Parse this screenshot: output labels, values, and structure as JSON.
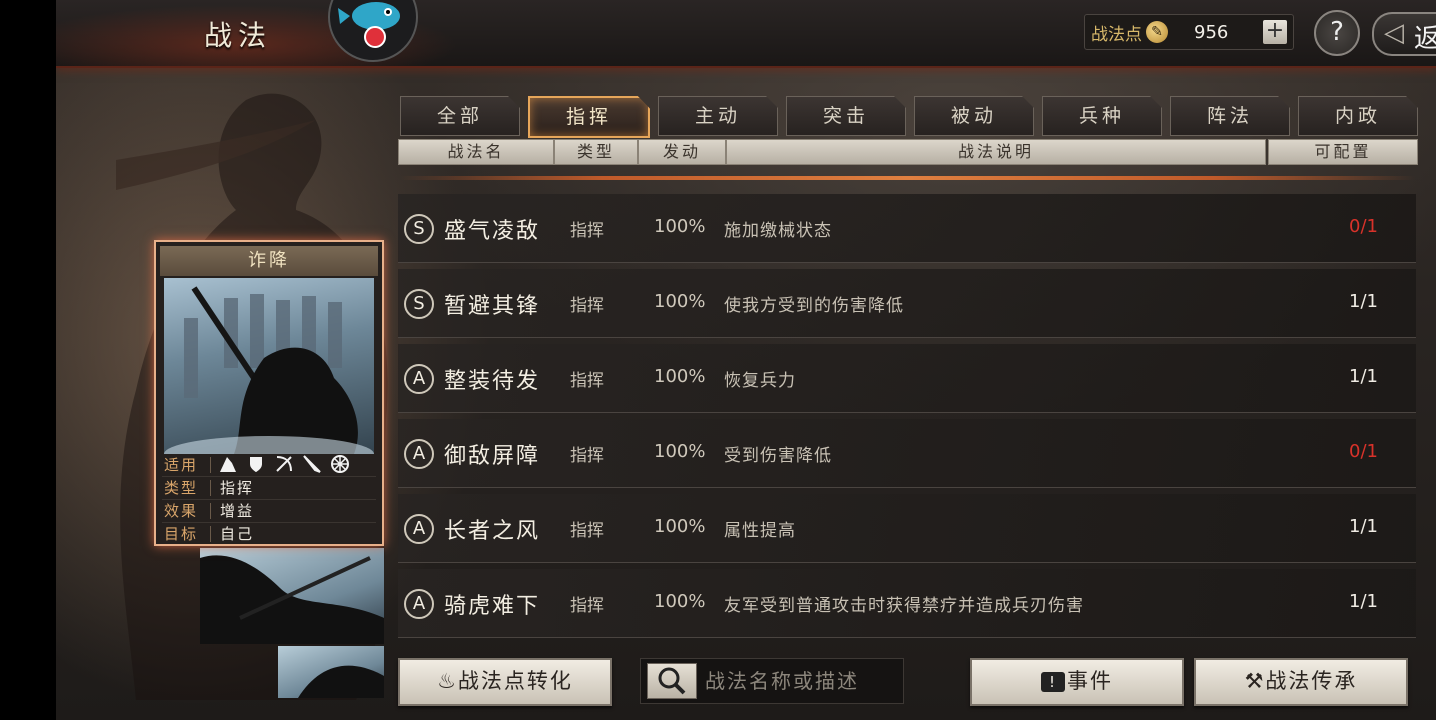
{
  "header": {
    "title": "战法",
    "points_label": "战法点",
    "points_value": "956",
    "add_label": "+",
    "help_label": "?",
    "back_label": "返"
  },
  "tabs": [
    {
      "label": "全部",
      "active": false
    },
    {
      "label": "指挥",
      "active": true
    },
    {
      "label": "主动",
      "active": false
    },
    {
      "label": "突击",
      "active": false
    },
    {
      "label": "被动",
      "active": false
    },
    {
      "label": "兵种",
      "active": false
    },
    {
      "label": "阵法",
      "active": false
    },
    {
      "label": "内政",
      "active": false
    }
  ],
  "columns": {
    "name": "战法名",
    "type": "类型",
    "rate": "发动",
    "desc": "战法说明",
    "slots": "可配置"
  },
  "tactics": [
    {
      "grade": "S",
      "name": "盛气凌敌",
      "type": "指挥",
      "rate": "100%",
      "desc": "施加缴械状态",
      "slots": "0/1",
      "empty": true
    },
    {
      "grade": "S",
      "name": "暂避其锋",
      "type": "指挥",
      "rate": "100%",
      "desc": "使我方受到的伤害降低",
      "slots": "1/1",
      "empty": false
    },
    {
      "grade": "A",
      "name": "整装待发",
      "type": "指挥",
      "rate": "100%",
      "desc": "恢复兵力",
      "slots": "1/1",
      "empty": false
    },
    {
      "grade": "A",
      "name": "御敌屏障",
      "type": "指挥",
      "rate": "100%",
      "desc": "受到伤害降低",
      "slots": "0/1",
      "empty": true
    },
    {
      "grade": "A",
      "name": "长者之风",
      "type": "指挥",
      "rate": "100%",
      "desc": "属性提高",
      "slots": "1/1",
      "empty": false
    },
    {
      "grade": "A",
      "name": "骑虎难下",
      "type": "指挥",
      "rate": "100%",
      "desc": "友军受到普通攻击时获得禁疗并造成兵刃伤害",
      "slots": "1/1",
      "empty": false
    }
  ],
  "card": {
    "title": "诈降",
    "applicable_label": "适用",
    "type_label": "类型",
    "type_value": "指挥",
    "effect_label": "效果",
    "effect_value": "增益",
    "target_label": "目标",
    "target_value": "自己",
    "troop_icons": [
      "cavalry-icon",
      "shield-icon",
      "bow-icon",
      "spear-icon",
      "wheel-icon"
    ]
  },
  "bottom": {
    "convert_label": "战法点转化",
    "search_placeholder": "战法名称或描述",
    "event_label": "事件",
    "inherit_label": "战法传承"
  },
  "colors": {
    "accent": "#e6a65a",
    "empty_slot": "#d8322a",
    "card_border": "#e8b08a"
  }
}
